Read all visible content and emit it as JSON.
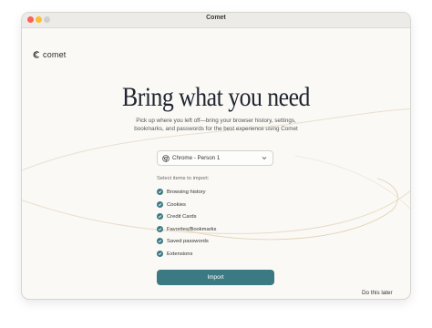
{
  "window": {
    "title": "Comet"
  },
  "brand": {
    "name": "comet",
    "icon": "comet-logo-icon"
  },
  "main": {
    "headline": "Bring what you need",
    "subtitle": "Pick up where you left off—bring your browser history, settings, bookmarks, and passwords for the best experience using Comet"
  },
  "browser_select": {
    "selected": "Chrome - Person 1",
    "icon": "chrome-icon"
  },
  "items_label": "Select items to import:",
  "items": [
    {
      "label": "Browsing history",
      "checked": true
    },
    {
      "label": "Cookies",
      "checked": true
    },
    {
      "label": "Credit Cards",
      "checked": true
    },
    {
      "label": "Favorites/Bookmarks",
      "checked": true
    },
    {
      "label": "Saved passwords",
      "checked": true
    },
    {
      "label": "Extensions",
      "checked": true
    }
  ],
  "actions": {
    "import_label": "Import",
    "later_label": "Do this later"
  },
  "colors": {
    "accent": "#3b7a82",
    "background": "#faf9f5"
  }
}
